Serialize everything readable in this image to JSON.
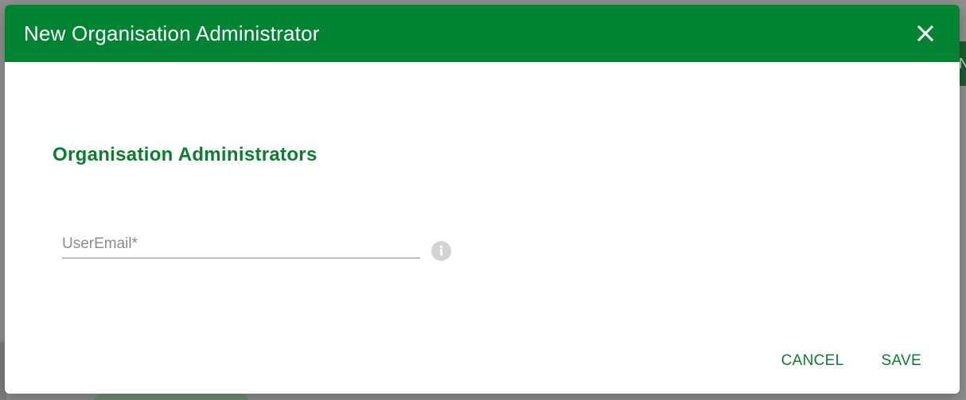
{
  "background": {
    "header_fragment": "N"
  },
  "dialog": {
    "title": "New Organisation Administrator",
    "close_icon": "close-icon",
    "section_title": "Organisation Administrators",
    "email_field": {
      "label": "UserEmail*",
      "value": "",
      "info_icon": "info-icon"
    },
    "actions": {
      "cancel_label": "CANCEL",
      "save_label": "SAVE"
    }
  },
  "colors": {
    "header_bg": "#008433",
    "accent_text": "#0b7d2e",
    "label_gray": "#8a8a8a",
    "scrim": "#8f8f8f"
  }
}
